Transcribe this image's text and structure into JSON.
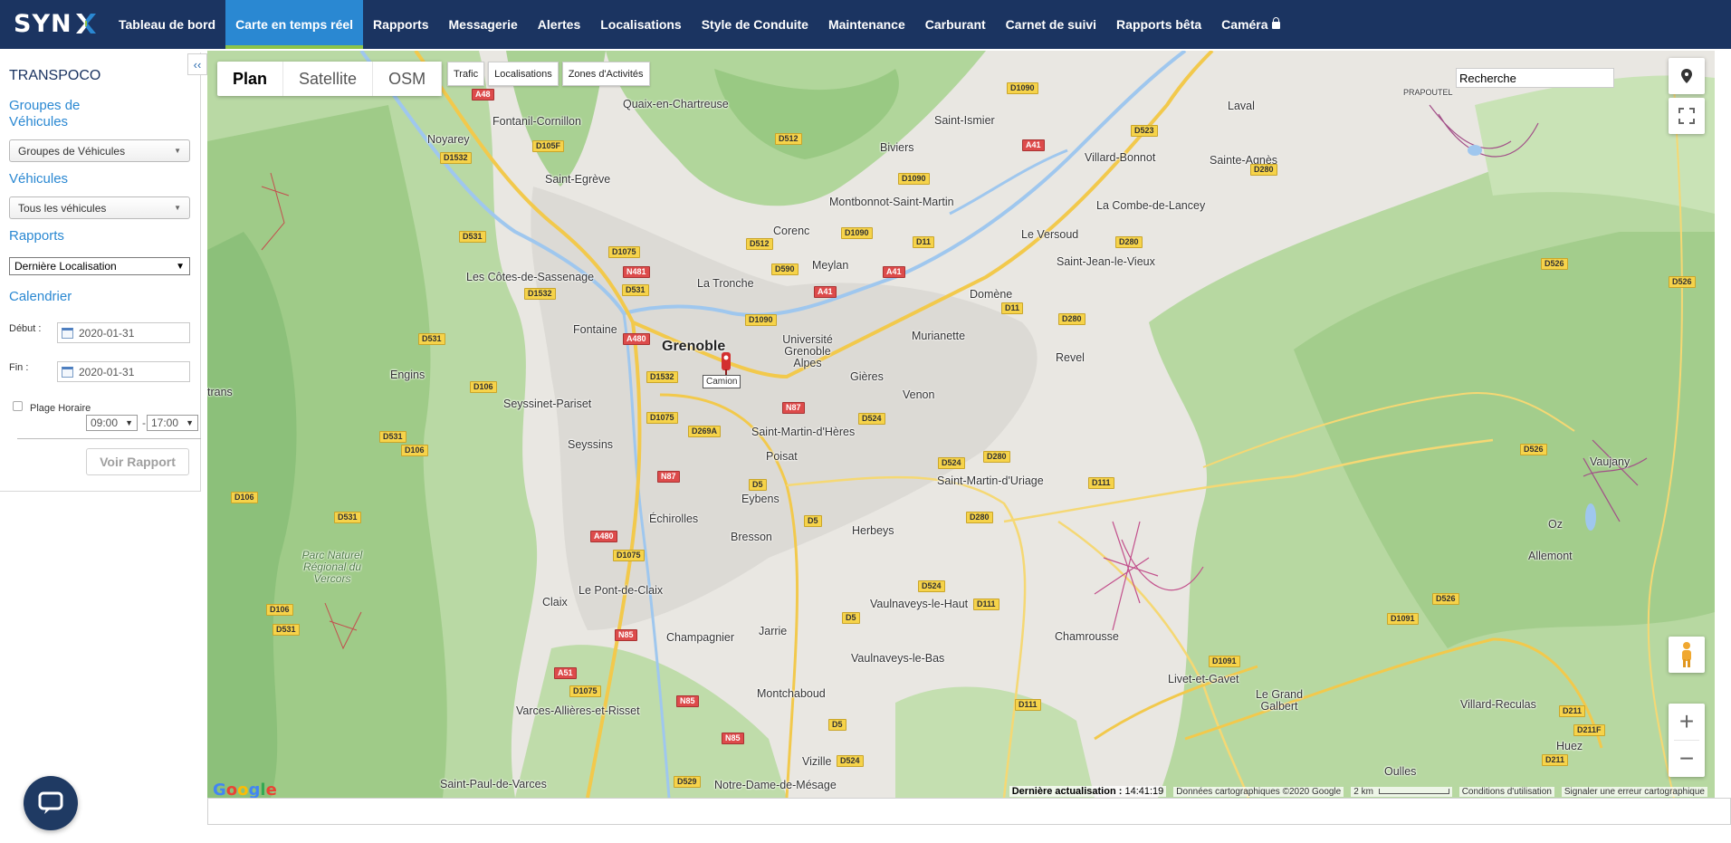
{
  "brand": {
    "logo_text": "SYN"
  },
  "nav": {
    "items": [
      {
        "label": "Tableau de bord"
      },
      {
        "label": "Carte en temps réel",
        "active": true
      },
      {
        "label": "Rapports"
      },
      {
        "label": "Messagerie"
      },
      {
        "label": "Alertes"
      },
      {
        "label": "Localisations"
      },
      {
        "label": "Style de Conduite"
      },
      {
        "label": "Maintenance"
      },
      {
        "label": "Carburant"
      },
      {
        "label": "Carnet de suivi"
      },
      {
        "label": "Rapports bêta"
      },
      {
        "label": "Caméra",
        "icon": "lock-icon"
      }
    ]
  },
  "sidebar": {
    "collapse_label": "‹‹",
    "company": "TRANSPOCO",
    "groups_label": "Groupes de Véhicules",
    "groups_select": "Groupes de Véhicules",
    "vehicles_label": "Véhicules",
    "vehicles_select": "Tous les véhicules",
    "reports_label": "Rapports",
    "reports_select": "Dernière Localisation",
    "calendar_label": "Calendrier",
    "start_label": "Début :",
    "start_date": "2020-01-31",
    "end_label": "Fin :",
    "end_date": "2020-01-31",
    "time_range_label": "Plage Horaire",
    "time_from": "09:00",
    "time_to": "17:00",
    "time_sep": "-",
    "submit_label": "Voir Rapport"
  },
  "map": {
    "type_buttons": {
      "plan": "Plan",
      "satellite": "Satellite",
      "osm": "OSM"
    },
    "overlays": {
      "traffic": "Trafic",
      "locations": "Localisations",
      "zones": "Zones d'Activités"
    },
    "search_value": "Recherche",
    "marker_label": "Camion",
    "zoom_in": "+",
    "zoom_out": "−",
    "places": {
      "grenoble": "Grenoble",
      "quaix": "Quaix-en-Chartreuse",
      "fontanil": "Fontanil-Cornillon",
      "noyarey": "Noyarey",
      "saint_egreve": "Saint-Egrève",
      "saint_ismier": "Saint-Ismier",
      "biviers": "Biviers",
      "laval": "Laval",
      "villard_bonnot": "Villard-Bonnot",
      "sainte_agnes": "Sainte-Agnès",
      "montbonnot": "Montbonnot-Saint-Martin",
      "combe_lancey": "La Combe-de-Lancey",
      "corenc": "Corenc",
      "le_versoud": "Le Versoud",
      "meylan": "Meylan",
      "saint_jean": "Saint-Jean-le-Vieux",
      "cotes_sassenage": "Les Côtes-de-Sassenage",
      "la_tronche": "La Tronche",
      "domene": "Domène",
      "fontaine": "Fontaine",
      "universite": "Université Grenoble Alpes",
      "murianette": "Murianette",
      "revel": "Revel",
      "engins": "Engins",
      "gieres": "Gières",
      "venon": "Venon",
      "seyssinet": "Seyssinet-Pariset",
      "seyssins": "Seyssins",
      "smh": "Saint-Martin-d'Hères",
      "poisat": "Poisat",
      "smu": "Saint-Martin-d'Uriage",
      "vaujany": "Vaujany",
      "eybens": "Eybens",
      "echirolles": "Échirolles",
      "herbeys": "Herbeys",
      "bresson": "Bresson",
      "oz": "Oz",
      "allemont": "Allemont",
      "parc": "Parc Naturel Régional du Vercors",
      "claix": "Claix",
      "pont_claix": "Le Pont-de-Claix",
      "vaulnaveys_haut": "Vaulnaveys-le-Haut",
      "chamrousse": "Chamrousse",
      "champagnier": "Champagnier",
      "jarrie": "Jarrie",
      "vaulnaveys_bas": "Vaulnaveys-le-Bas",
      "livet_gavet": "Livet-et-Gavet",
      "grand_galbert": "Le Grand Galbert",
      "villard_reculas": "Villard-Reculas",
      "montchaboud": "Montchaboud",
      "varces": "Varces-Allières-et-Risset",
      "huez": "Huez",
      "vizille": "Vizille",
      "oulles": "Oulles",
      "saint_paul": "Saint-Paul-de-Varces",
      "notre_dame": "Notre-Dame-de-Mésage",
      "prapoutel": "PRAPOUTEL",
      "trans": "trans"
    },
    "roads": {
      "a48": "A48",
      "d1090a": "D1090",
      "d105f": "D105F",
      "d512a": "D512",
      "a41a": "A41",
      "d523": "D523",
      "d1532a": "D1532",
      "d1090b": "D1090",
      "d280a": "D280",
      "d531a": "D531",
      "d1075a": "D1075",
      "n481": "N481",
      "d512b": "D512",
      "d1090c": "D1090",
      "d11": "D11",
      "d280b": "D280",
      "d590": "D590",
      "a41b": "A41",
      "d526a": "D526",
      "d1532b": "D1532",
      "d531b": "D531",
      "a41c": "A41",
      "d526b": "D526",
      "d11b": "D11",
      "d1090d": "D1090",
      "d280c": "D280",
      "a480a": "A480",
      "d531c": "D531",
      "d1532c": "D1532",
      "d106a": "D106",
      "n87a": "N87",
      "d1075b": "D1075",
      "d524a": "D524",
      "d269a": "D269A",
      "d531d": "D531",
      "d106b": "D106",
      "d280d": "D280",
      "d524b": "D524",
      "d526c": "D526",
      "n87b": "N87",
      "d111a": "D111",
      "d5a": "D5",
      "d106c": "D106",
      "d5b": "D5",
      "d280e": "D280",
      "d531e": "D531",
      "a480b": "A480",
      "d1075c": "D1075",
      "d524c": "D524",
      "d526d": "D526",
      "d106d": "D106",
      "d111b": "D111",
      "d1091a": "D1091",
      "d531f": "D531",
      "n85a": "N85",
      "d5c": "D5",
      "d1091b": "D1091",
      "a51": "A51",
      "d1075d": "D1075",
      "n85b": "N85",
      "d111c": "D111",
      "d211a": "D211",
      "d5d": "D5",
      "d211f": "D211F",
      "n85c": "N85",
      "d211b": "D211",
      "d524d": "D524",
      "d529": "D529"
    },
    "last_update_label": "Dernière actualisation :",
    "last_update_time": "14:41:19",
    "copyright": "Données cartographiques ©2020 Google",
    "scale": "2 km",
    "terms": "Conditions d'utilisation",
    "report_error": "Signaler une erreur cartographique",
    "google_logo": "Google"
  },
  "colors": {
    "navbar": "#1b3461",
    "active_tab": "#2a88d2",
    "active_underline": "#8bc34a",
    "accent": "#2a88d2"
  }
}
